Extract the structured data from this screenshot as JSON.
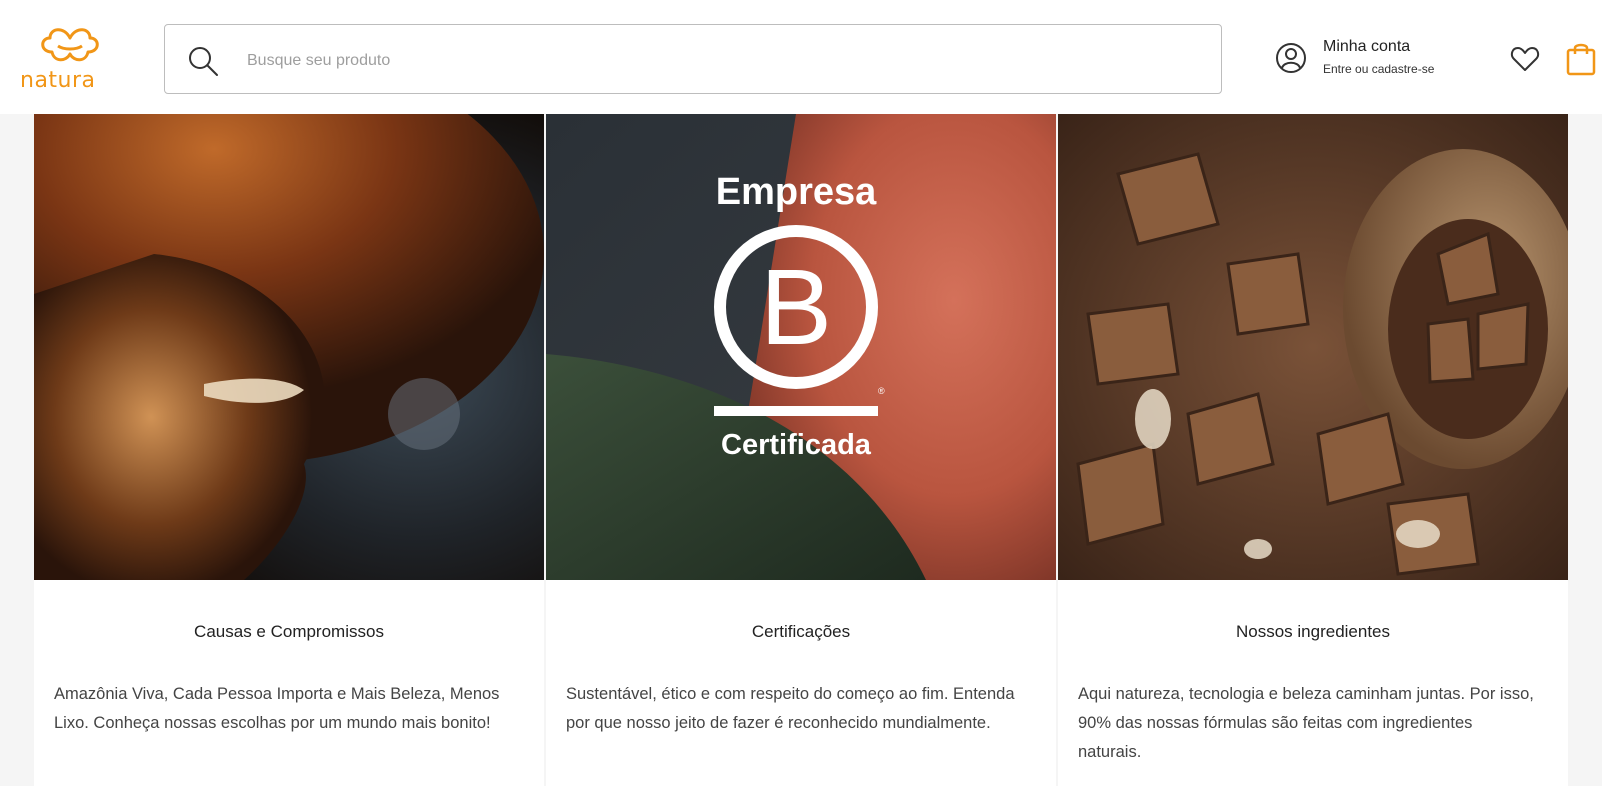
{
  "header": {
    "logo_text": "natura",
    "search": {
      "placeholder": "Busque seu produto",
      "value": ""
    },
    "account": {
      "title": "Minha conta",
      "subtitle": "Entre ou cadastre-se"
    },
    "icons": [
      "search-icon",
      "user-icon",
      "heart-icon",
      "bag-icon"
    ]
  },
  "cards": [
    {
      "title": "Causas e Compromissos",
      "description": "Amazônia Viva, Cada Pessoa Importa e Mais Beleza, Menos Lixo. Conheça nossas escolhas por um mundo mais bonito!"
    },
    {
      "title": "Certificações",
      "description": "Sustentável, ético e com respeito do começo ao fim. Entenda por que nosso jeito de fazer é reconhecido mundialmente.",
      "badge": {
        "top": "Empresa",
        "letter": "B",
        "bottom": "Certificada",
        "mark": "®"
      }
    },
    {
      "title": "Nossos ingredientes",
      "description": "Aqui natureza, tecnologia e beleza caminham juntas. Por isso, 90% das nossas fórmulas são feitas com ingredientes naturais."
    }
  ],
  "colors": {
    "brand": "#f19617",
    "background": "#f5f5f5"
  }
}
